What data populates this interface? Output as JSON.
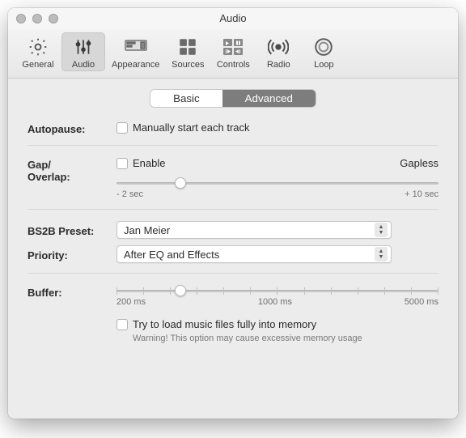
{
  "window": {
    "title": "Audio"
  },
  "toolbar": {
    "items": [
      {
        "label": "General"
      },
      {
        "label": "Audio"
      },
      {
        "label": "Appearance"
      },
      {
        "label": "Sources"
      },
      {
        "label": "Controls"
      },
      {
        "label": "Radio"
      },
      {
        "label": "Loop"
      }
    ]
  },
  "tabs": {
    "basic": "Basic",
    "advanced": "Advanced"
  },
  "autopause": {
    "label": "Autopause:",
    "checkbox": "Manually start each track"
  },
  "gap": {
    "label": "Gap/\nOverlap:",
    "enable": "Enable",
    "gapless": "Gapless",
    "min": "- 2 sec",
    "max": "+ 10 sec"
  },
  "bs2b": {
    "label": "BS2B Preset:",
    "value": "Jan Meier"
  },
  "priority": {
    "label": "Priority:",
    "value": "After EQ and Effects"
  },
  "buffer": {
    "label": "Buffer:",
    "t1": "200 ms",
    "t2": "1000 ms",
    "t3": "5000 ms"
  },
  "memory": {
    "checkbox": "Try to load music files fully into memory",
    "warning": "Warning! This option may cause excessive memory usage"
  }
}
